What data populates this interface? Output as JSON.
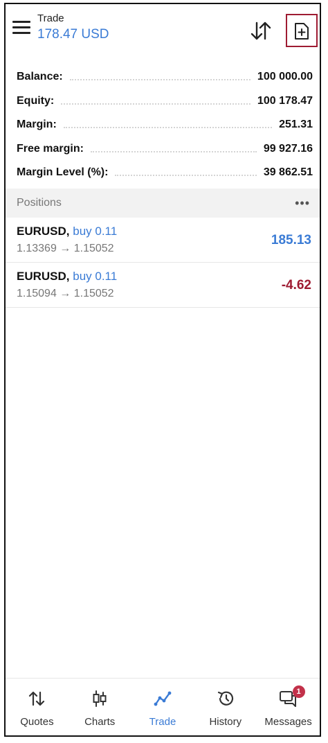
{
  "header": {
    "title": "Trade",
    "subtitle": "178.47 USD"
  },
  "summary": [
    {
      "label": "Balance:",
      "value": "100 000.00"
    },
    {
      "label": "Equity:",
      "value": "100 178.47"
    },
    {
      "label": "Margin:",
      "value": "251.31"
    },
    {
      "label": "Free margin:",
      "value": "99 927.16"
    },
    {
      "label": "Margin Level (%):",
      "value": "39 862.51"
    }
  ],
  "positions": {
    "label": "Positions",
    "more": "•••",
    "items": [
      {
        "symbol": "EURUSD,",
        "side": "buy 0.11",
        "prices": "1.13369 → 1.15052",
        "profit": "185.13"
      },
      {
        "symbol": "EURUSD,",
        "side": "buy 0.11",
        "prices": "1.15094 → 1.15052",
        "profit": "-4.62"
      }
    ]
  },
  "nav": {
    "items": [
      {
        "label": "Quotes",
        "icon": "quotes-icon"
      },
      {
        "label": "Charts",
        "icon": "charts-icon"
      },
      {
        "label": "Trade",
        "icon": "trade-icon",
        "active": true
      },
      {
        "label": "History",
        "icon": "history-icon"
      },
      {
        "label": "Messages",
        "icon": "messages-icon",
        "badge": "1"
      }
    ]
  },
  "colors": {
    "accent": "#3a7bd5",
    "negative": "#9e1b32",
    "highlight_border": "#9e1b32",
    "badge": "#c2314a"
  }
}
